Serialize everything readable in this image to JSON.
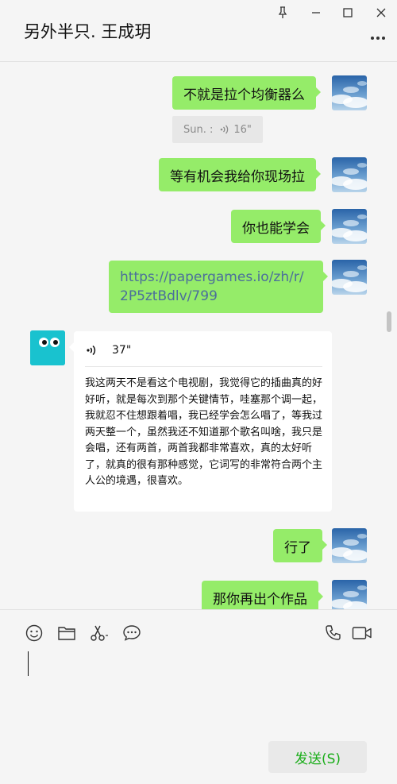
{
  "window": {
    "title": "另外半只. 王成玥",
    "buttons": [
      "pin-icon",
      "minimize-icon",
      "maximize-icon",
      "close-icon"
    ],
    "more_icon": "more-icon"
  },
  "messages": [
    {
      "from": "self",
      "type": "text",
      "text": "不就是拉个均衡器么"
    },
    {
      "from": "self",
      "type": "voice",
      "text": "Sun. :",
      "duration": "16\""
    },
    {
      "from": "self",
      "type": "text",
      "text": "等有机会我给你现场拉"
    },
    {
      "from": "self",
      "type": "text",
      "text": "你也能学会"
    },
    {
      "from": "self",
      "type": "link",
      "text": "https://papergames.io/zh/r/2P5ztBdlv/799"
    },
    {
      "from": "other",
      "type": "voice",
      "duration": "37\"",
      "transcript": "我这两天不是看这个电视剧，我觉得它的插曲真的好好听，就是每次到那个关键情节，哇塞那个调一起，我就忍不住想跟着唱，我已经学会怎么唱了，等我过两天整一个，虽然我还不知道那个歌名叫啥，我只是会唱，还有两首，两首我都非常喜欢，真的太好听了，就真的很有那种感觉，它词写的非常符合两个主人公的境遇，很喜欢。"
    },
    {
      "from": "self",
      "type": "text",
      "text": "行了"
    },
    {
      "from": "self",
      "type": "text",
      "text": "那你再出个作品"
    }
  ],
  "toolbar": {
    "left": [
      "emoji-icon",
      "folder-icon",
      "scissors-icon",
      "chat-bubble-icon"
    ],
    "right": [
      "phone-icon",
      "video-icon"
    ]
  },
  "composer": {
    "value": ""
  },
  "send_label": "发送(S)",
  "colors": {
    "bubble_self": "#95ec69",
    "link_text": "#4b6e9b",
    "send_text": "#1aad19",
    "avatar_other": "#19c2cf"
  }
}
